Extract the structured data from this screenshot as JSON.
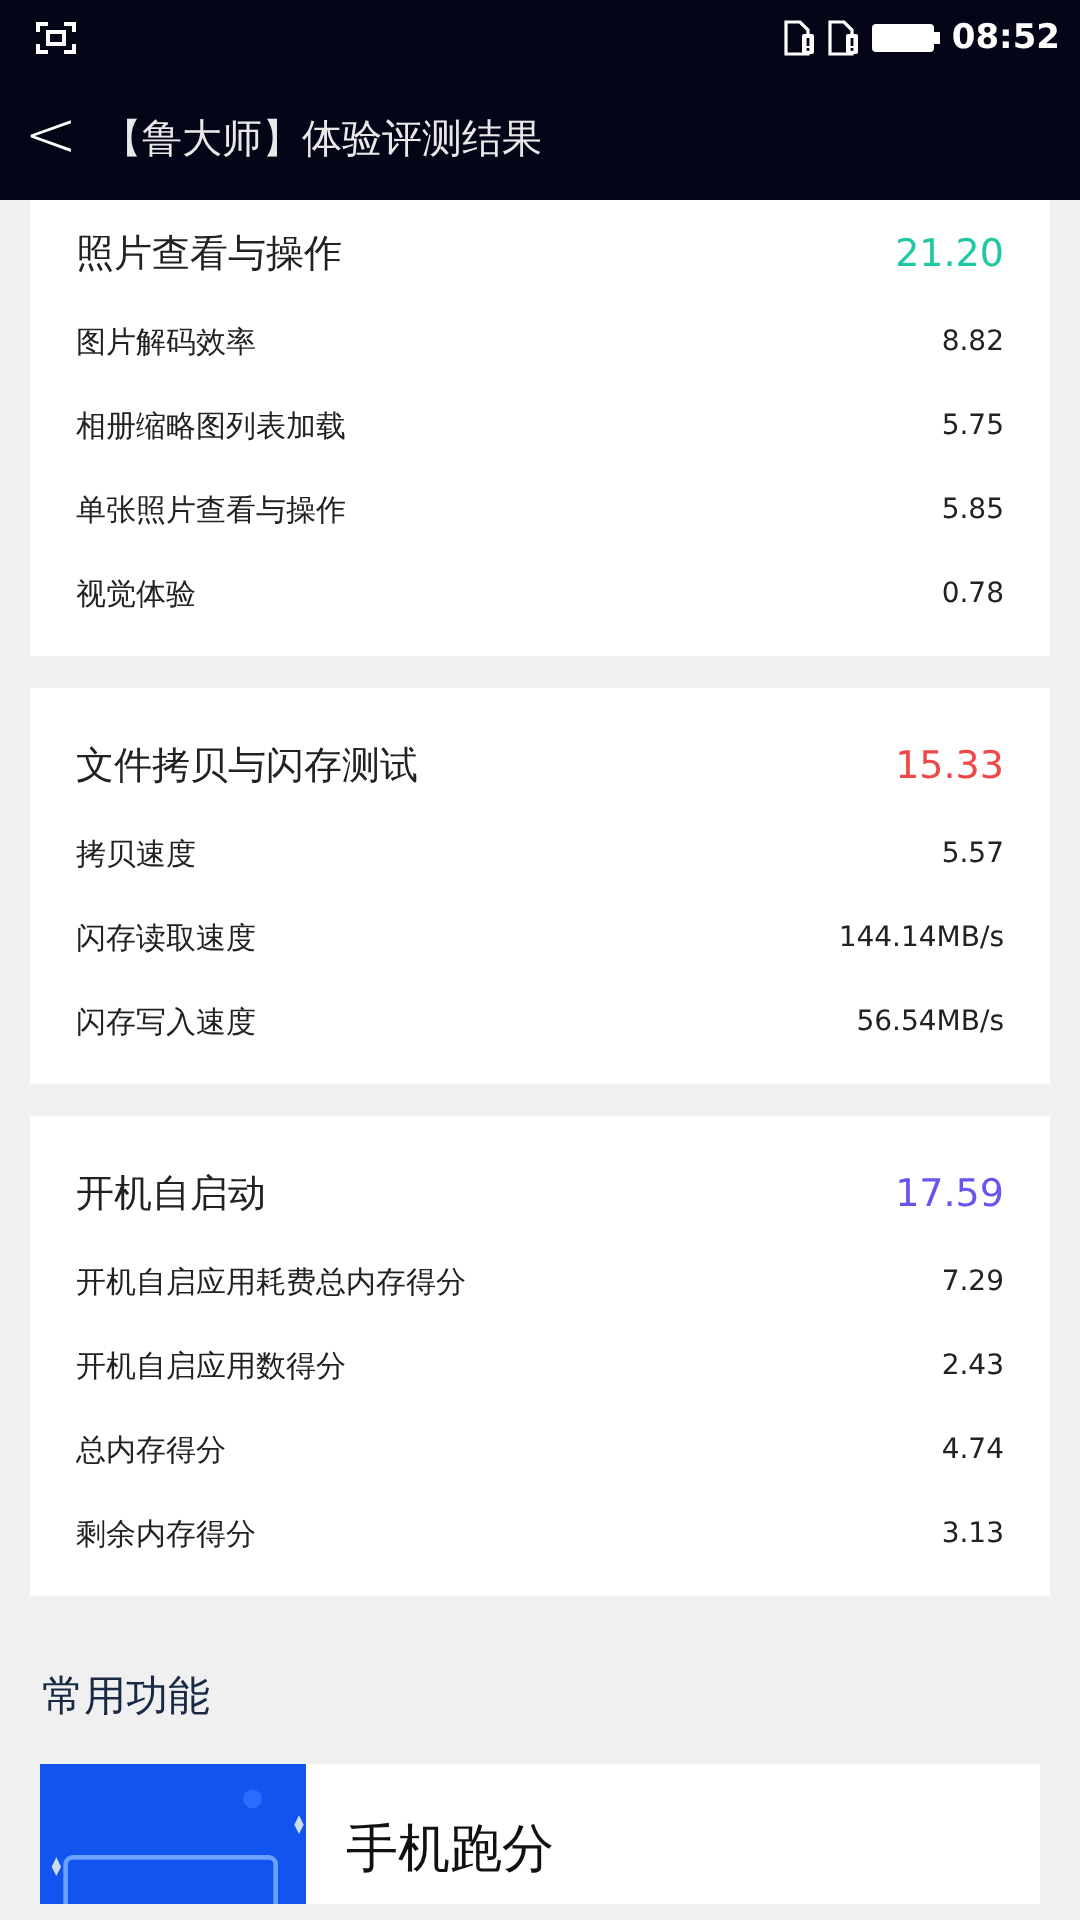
{
  "status_bar": {
    "time": "08:52"
  },
  "header": {
    "back": "<",
    "title": "【鲁大师】体验评测结果"
  },
  "sections": [
    {
      "title": "照片查看与操作",
      "score": "21.20",
      "color": "#1ec8a5",
      "items": [
        {
          "label": "图片解码效率",
          "value": "8.82"
        },
        {
          "label": "相册缩略图列表加载",
          "value": "5.75"
        },
        {
          "label": "单张照片查看与操作",
          "value": "5.85"
        },
        {
          "label": "视觉体验",
          "value": "0.78"
        }
      ]
    },
    {
      "title": "文件拷贝与闪存测试",
      "score": "15.33",
      "color": "#f04848",
      "items": [
        {
          "label": "拷贝速度",
          "value": "5.57"
        },
        {
          "label": "闪存读取速度",
          "value": "144.14MB/s"
        },
        {
          "label": "闪存写入速度",
          "value": "56.54MB/s"
        }
      ]
    },
    {
      "title": "开机自启动",
      "score": "17.59",
      "color": "#6655ee",
      "items": [
        {
          "label": "开机自启应用耗费总内存得分",
          "value": "7.29"
        },
        {
          "label": "开机自启应用数得分",
          "value": "2.43"
        },
        {
          "label": "总内存得分",
          "value": "4.74"
        },
        {
          "label": "剩余内存得分",
          "value": "3.13"
        }
      ]
    }
  ],
  "common": {
    "title": "常用功能",
    "feature": {
      "kind": "picture",
      "label": "手机跑分"
    }
  }
}
